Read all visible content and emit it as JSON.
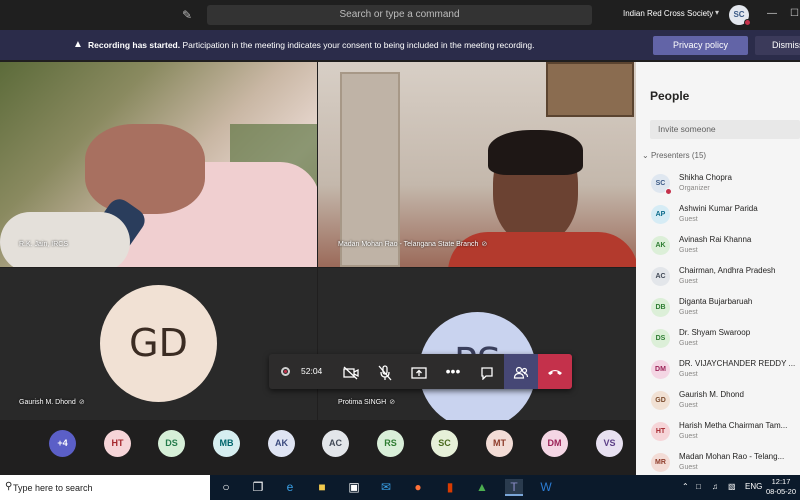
{
  "titlebar": {
    "search_placeholder": "Search or type a command",
    "org_name": "Indian Red Cross Society",
    "me_initials": "SC"
  },
  "banner": {
    "bold_text": "Recording has started.",
    "text": "Participation in the meeting indicates your consent to being included in the meeting recording.",
    "privacy_label": "Privacy policy",
    "dismiss_label": "Dismiss"
  },
  "tiles": {
    "t1_label": "R.K. Jain, IRCS",
    "t2_label": "Madan Mohan Rao - Telangana State Branch",
    "t3_initials": "GD",
    "t3_label": "Gaurish M. Dhond",
    "t4_initials": "PS",
    "t4_label": "Protima SINGH"
  },
  "controls": {
    "call_time": "52:04"
  },
  "strip": [
    {
      "initials": "+4",
      "bg": "#5b5fc7",
      "fg": "#ffffff"
    },
    {
      "initials": "HT",
      "bg": "#f6d5d8",
      "fg": "#a4262c"
    },
    {
      "initials": "DS",
      "bg": "#d6efd8",
      "fg": "#237b4b"
    },
    {
      "initials": "MB",
      "bg": "#d6eef0",
      "fg": "#00666d"
    },
    {
      "initials": "AK",
      "bg": "#dfe4f3",
      "fg": "#3b4a7e"
    },
    {
      "initials": "AC",
      "bg": "#e3e6ea",
      "fg": "#424a57"
    },
    {
      "initials": "RS",
      "bg": "#d9efd9",
      "fg": "#2e7d32"
    },
    {
      "initials": "SC",
      "bg": "#e6f0d8",
      "fg": "#4a6b1e"
    },
    {
      "initials": "MT",
      "bg": "#f3dcd6",
      "fg": "#8e3b2a"
    },
    {
      "initials": "DM",
      "bg": "#f4d6e4",
      "fg": "#9b2257"
    },
    {
      "initials": "VS",
      "bg": "#e8e1f1",
      "fg": "#5c3f87"
    }
  ],
  "people": {
    "title": "People",
    "invite_placeholder": "Invite someone",
    "presenters_label": "Presenters (15)",
    "list": [
      {
        "initials": "SC",
        "name": "Shikha Chopra",
        "role": "Organizer",
        "bg": "#dfe7f0",
        "fg": "#3b5a86"
      },
      {
        "initials": "AP",
        "name": "Ashwini Kumar Parida",
        "role": "Guest",
        "bg": "#d6ecf5",
        "fg": "#0b6a8a"
      },
      {
        "initials": "AK",
        "name": "Avinash Rai Khanna",
        "role": "Guest",
        "bg": "#dcefd8",
        "fg": "#2e7d32"
      },
      {
        "initials": "AC",
        "name": "Chairman, Andhra Pradesh",
        "role": "Guest",
        "bg": "#e3e6ea",
        "fg": "#424a57"
      },
      {
        "initials": "DB",
        "name": "Diganta Bujarbaruah",
        "role": "Guest",
        "bg": "#dcefd8",
        "fg": "#2e7d32"
      },
      {
        "initials": "DS",
        "name": "Dr. Shyam Swaroop",
        "role": "Guest",
        "bg": "#dcefd8",
        "fg": "#2e7d32"
      },
      {
        "initials": "DM",
        "name": "DR. VIJAYCHANDER REDDY ...",
        "role": "Guest",
        "bg": "#f4d6e4",
        "fg": "#9b2257"
      },
      {
        "initials": "GD",
        "name": "Gaurish M. Dhond",
        "role": "Guest",
        "bg": "#f1e1d4",
        "fg": "#7a4a2c"
      },
      {
        "initials": "HT",
        "name": "Harish Metha Chairman Tam...",
        "role": "Guest",
        "bg": "#f6d5d8",
        "fg": "#a4262c"
      },
      {
        "initials": "MR",
        "name": "Madan Mohan Rao - Telang...",
        "role": "Guest",
        "bg": "#f3dcd6",
        "fg": "#8e3b2a"
      }
    ]
  },
  "taskbar": {
    "search_text": "Type here to search",
    "lang": "ENG",
    "time": "12:17",
    "date": "08-05-20"
  }
}
